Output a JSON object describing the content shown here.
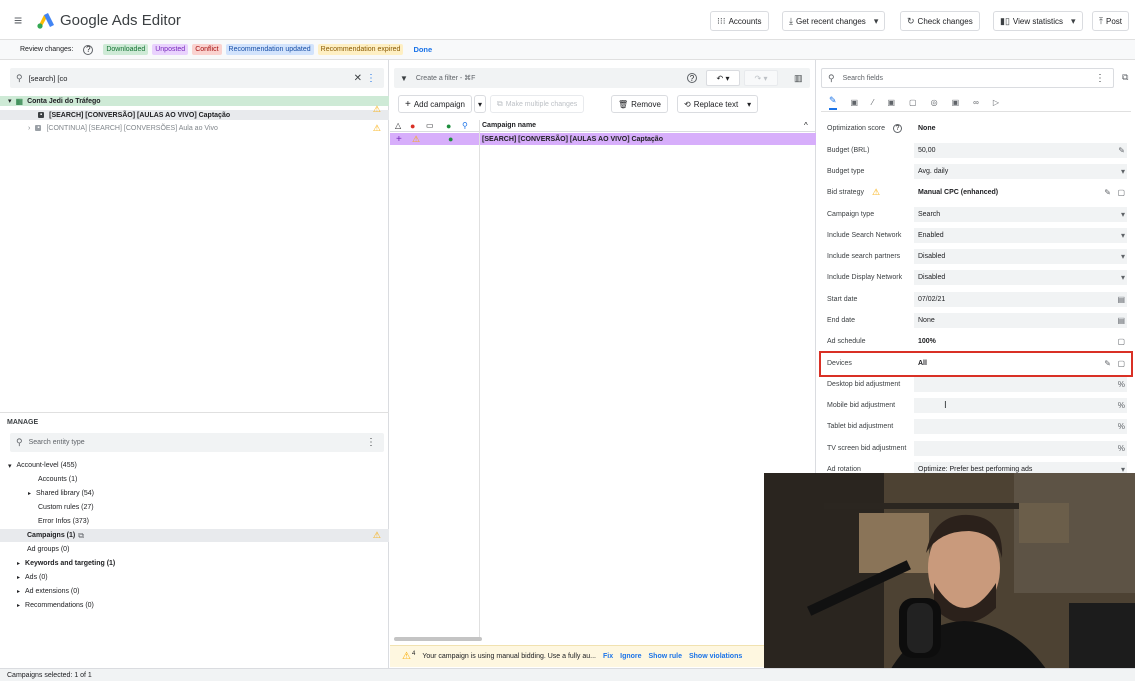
{
  "app": {
    "title": "Google Ads Editor"
  },
  "toolbar": {
    "accounts": "Accounts",
    "get_recent": "Get recent changes",
    "check_changes": "Check changes",
    "view_statistics": "View statistics",
    "post": "Post"
  },
  "review": {
    "label": "Review changes:",
    "chips": [
      {
        "label": "Downloaded",
        "bg": "#ceead6",
        "fg": "#137333"
      },
      {
        "label": "Unposted",
        "bg": "#e9d2fd",
        "fg": "#7627bb"
      },
      {
        "label": "Conflict",
        "bg": "#fad2cf",
        "fg": "#a50e0e"
      },
      {
        "label": "Recommendation updated",
        "bg": "#d2e3fc",
        "fg": "#174ea6"
      },
      {
        "label": "Recommendation expired",
        "bg": "#feefc3",
        "fg": "#8a5a00"
      }
    ],
    "done": "Done"
  },
  "left": {
    "search_value": "[search] [co",
    "tree": [
      {
        "label": "Conta Jedi do Tráfego"
      },
      {
        "label": "[SEARCH] [CONVERSÃO] [AULAS AO VIVO] Captação"
      },
      {
        "label": "[CONTINUA] [SEARCH] [CONVERSÕES] Aula ao Vivo"
      }
    ],
    "manage_title": "MANAGE",
    "manage_search_placeholder": "Search entity type",
    "manage_items": [
      "Account-level (455)",
      "Accounts (1)",
      "Shared library (54)",
      "Custom rules (27)",
      "Error Infos (373)",
      "Campaigns (1)",
      "Ad groups (0)",
      "Keywords and targeting (1)",
      "Ads (0)",
      "Ad extensions (0)",
      "Recommendations (0)"
    ]
  },
  "middle": {
    "filter_placeholder": "Create a filter - ⌘F",
    "add_campaign": "Add campaign",
    "make_multiple": "Make multiple changes",
    "remove": "Remove",
    "replace_text": "Replace text",
    "col_campaign_name": "Campaign name",
    "row_campaign": "[SEARCH] [CONVERSÃO] [AULAS AO VIVO] Captação",
    "status_count": "4",
    "status_text": "Your campaign is using manual bidding. Use a fully au...",
    "fix": "Fix",
    "ignore": "Ignore",
    "show_rule": "Show rule",
    "show_violations": "Show violations"
  },
  "right": {
    "search_placeholder": "Search fields",
    "props": [
      {
        "label": "Optimization score",
        "value": "None",
        "plain": true
      },
      {
        "label": "Budget (BRL)",
        "value": "50,00"
      },
      {
        "label": "Budget type",
        "value": "Avg. daily"
      },
      {
        "label": "Bid strategy",
        "value": "Manual CPC (enhanced)",
        "plain": true
      },
      {
        "label": "Campaign type",
        "value": "Search"
      },
      {
        "label": "Include Search Network",
        "value": "Enabled"
      },
      {
        "label": "Include search partners",
        "value": "Disabled"
      },
      {
        "label": "Include Display Network",
        "value": "Disabled"
      },
      {
        "label": "Start date",
        "value": "07/02/21"
      },
      {
        "label": "End date",
        "value": "None"
      },
      {
        "label": "Ad schedule",
        "value": "100%",
        "plain": true
      },
      {
        "label": "Devices",
        "value": "All",
        "plain": true
      },
      {
        "label": "Desktop bid adjustment",
        "value": ""
      },
      {
        "label": "Mobile bid adjustment",
        "value": ""
      },
      {
        "label": "Tablet bid adjustment",
        "value": ""
      },
      {
        "label": "TV screen bid adjustment",
        "value": ""
      },
      {
        "label": "Ad rotation",
        "value": "Optimize: Prefer best performing ads"
      }
    ]
  },
  "status": {
    "selected": "Campaigns selected: 1 of 1"
  }
}
